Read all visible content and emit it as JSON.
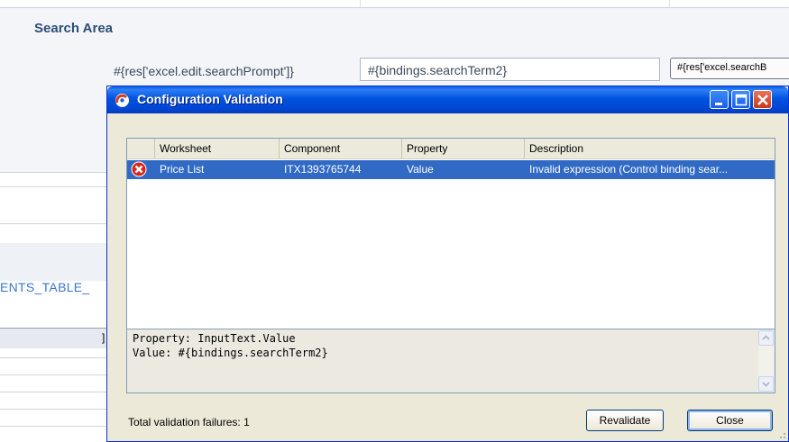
{
  "background": {
    "section_title": "Search Area",
    "search_prompt": "#{res['excel.edit.searchPrompt']}",
    "search_value": "#{bindings.searchTerm2}",
    "search_button": "#{res['excel.searchB",
    "table_label": "ENTS_TABLE_",
    "cell_marker": "]"
  },
  "dialog": {
    "title": "Configuration Validation",
    "columns": [
      "Worksheet",
      "Component",
      "Property",
      "Description"
    ],
    "rows": [
      {
        "worksheet": "Price List",
        "component": "ITX1393765744",
        "property": "Value",
        "description": "Invalid expression (Control binding sear..."
      }
    ],
    "detail": {
      "line1": "Property: InputText.Value",
      "line2": "Value: #{bindings.searchTerm2}"
    },
    "footer_status": "Total validation failures: 1",
    "revalidate_label": "Revalidate",
    "close_label": "Close"
  },
  "icons": {
    "app": "app-icon",
    "minimize": "minimize-icon",
    "maximize": "maximize-icon",
    "close": "close-icon",
    "row_error": "error-icon"
  },
  "colors": {
    "titlebar": "#0052e0",
    "selection": "#316ac5",
    "close_button": "#c5391d",
    "dialog_bg": "#ece9d8",
    "section_title": "#2d4d76",
    "link": "#3b75d1"
  }
}
